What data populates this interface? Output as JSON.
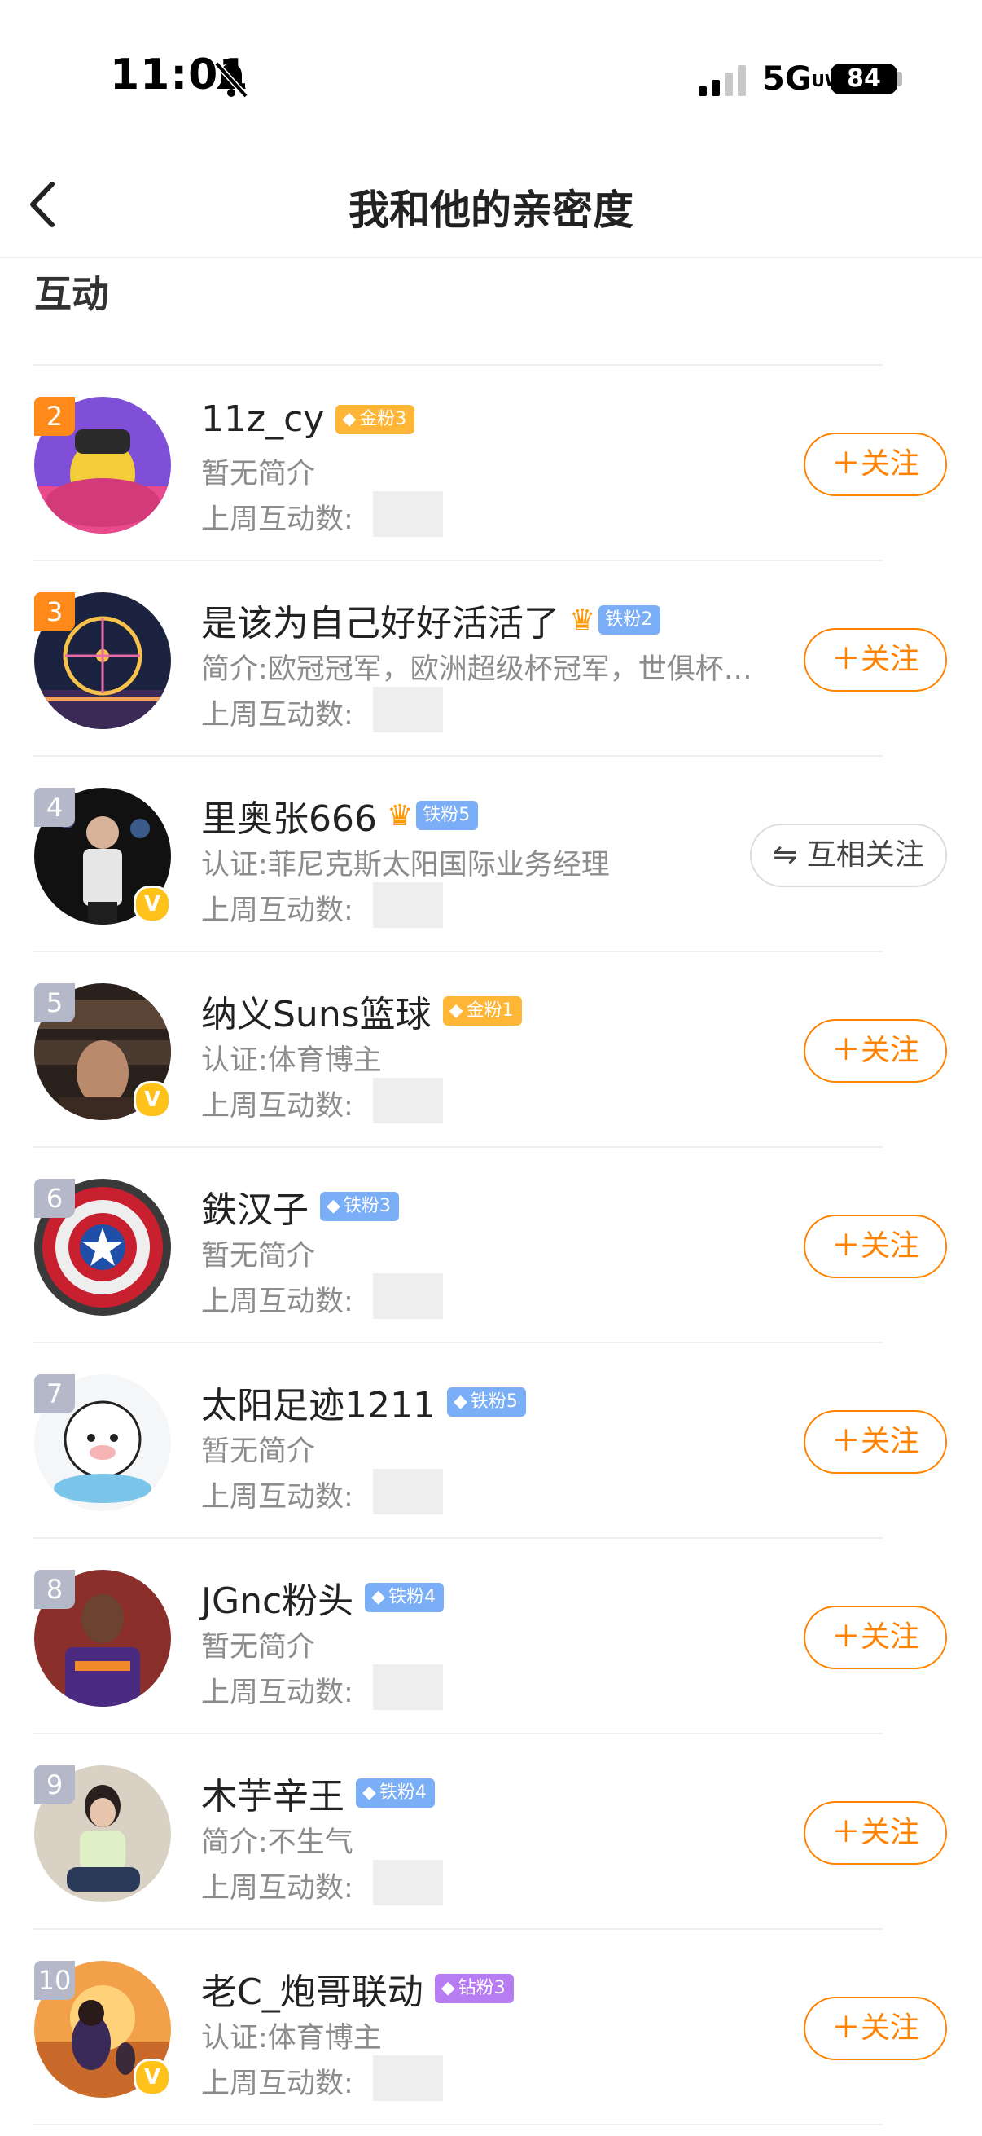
{
  "status": {
    "time": "11:01",
    "network": "5G",
    "network_suffix": "UW",
    "battery": "84"
  },
  "nav": {
    "title": "我和他的亲密度"
  },
  "section": {
    "title": "互动"
  },
  "interact_label": "上周互动数:",
  "users": [
    {
      "rank": "2",
      "name": "11z_cy",
      "badge": "金粉3",
      "desc": "暂无简介",
      "action": "关注"
    },
    {
      "rank": "3",
      "name": "是该为自己好好活活了",
      "badge": "铁粉2",
      "desc": "简介:欧冠冠军，欧洲超级杯冠军，世俱杯冠军",
      "action": "关注"
    },
    {
      "rank": "4",
      "name": "里奥张666",
      "badge": "铁粉5",
      "desc": "认证:菲尼克斯太阳国际业务经理",
      "action": "互相关注"
    },
    {
      "rank": "5",
      "name": "纳义Suns篮球",
      "badge": "金粉1",
      "desc": "认证:体育博主",
      "action": "关注"
    },
    {
      "rank": "6",
      "name": "鉄汉子",
      "badge": "铁粉3",
      "desc": "暂无简介",
      "action": "关注"
    },
    {
      "rank": "7",
      "name": "太阳足迹1211",
      "badge": "铁粉5",
      "desc": "暂无简介",
      "action": "关注"
    },
    {
      "rank": "8",
      "name": "JGnc粉头",
      "badge": "铁粉4",
      "desc": "暂无简介",
      "action": "关注"
    },
    {
      "rank": "9",
      "name": "木芋辛王",
      "badge": "铁粉4",
      "desc": "简介:不生气",
      "action": "关注"
    },
    {
      "rank": "10",
      "name": "老C_炮哥联动",
      "badge": "钻粉3",
      "desc": "认证:体育博主",
      "action": "关注"
    }
  ],
  "icons": {
    "back": "chevron-left-icon",
    "bell": "bell-off-icon",
    "crown": "crown-icon",
    "verified": "verified-v-icon"
  },
  "colors": {
    "accent": "#ff8200",
    "gold_badge": "#ffb636",
    "iron_badge": "#7aaef6",
    "diamond_badge": "#b87cf2"
  }
}
